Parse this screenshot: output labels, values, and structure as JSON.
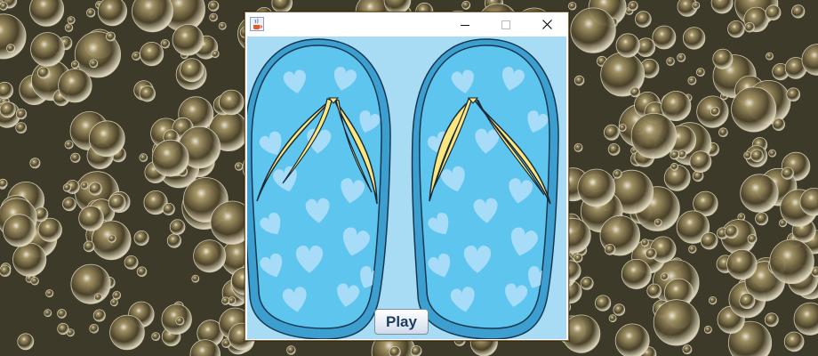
{
  "desktop": {
    "wallpaper": "bubbles-on-water",
    "base_color": "#3e3a2a"
  },
  "window": {
    "app_icon": "java-cup-icon",
    "controls": {
      "minimize": "minimize-icon",
      "maximize": "maximize-icon",
      "close": "close-icon"
    },
    "title": ""
  },
  "content": {
    "background": "#a8dcf4",
    "art": {
      "subject": "pair-of-flip-flops",
      "pattern": "hearts",
      "sole_outer": "#3c9fcf",
      "sole_inner": "#5ec5ef",
      "heart_color": "#a6dcf7",
      "strap_color": "#fbe680"
    },
    "play_button": {
      "label": "Play"
    }
  }
}
